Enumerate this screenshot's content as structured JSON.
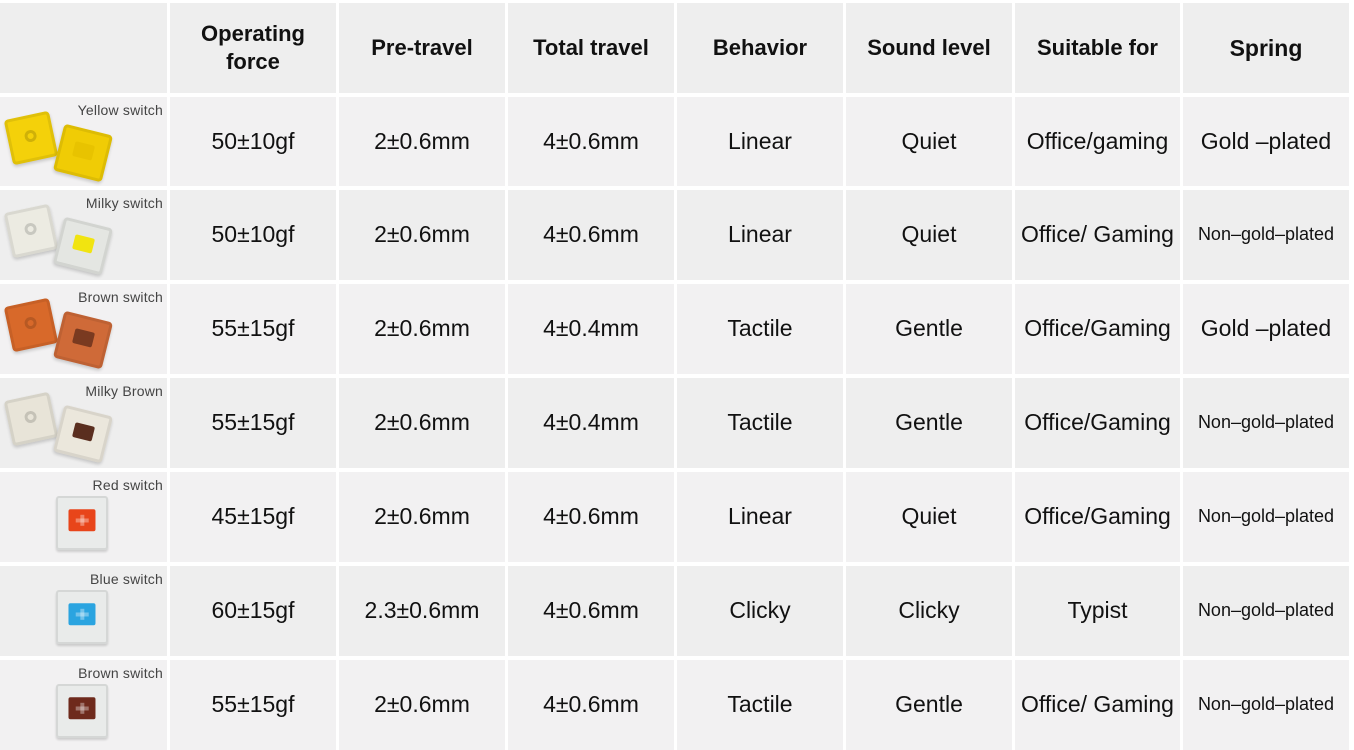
{
  "table": {
    "headers": [
      "",
      "Operating force",
      "Pre-travel",
      "Total travel",
      "Behavior",
      "Sound level",
      "Suitable for",
      "Spring"
    ],
    "header_lines": {
      "operating_force": [
        "Operating",
        "force"
      ]
    },
    "rows": [
      {
        "switch": "Yellow switch",
        "operating_force": "50±10gf",
        "pre_travel": "2±0.6mm",
        "total_travel": "4±0.6mm",
        "behavior": "Linear",
        "sound_level": "Quiet",
        "suitable_for": "Office/gaming",
        "spring": "Gold –plated"
      },
      {
        "switch": "Milky switch",
        "operating_force": "50±10gf",
        "pre_travel": "2±0.6mm",
        "total_travel": "4±0.6mm",
        "behavior": "Linear",
        "sound_level": "Quiet",
        "suitable_for": "Office/ Gaming",
        "spring": "Non–gold–plated"
      },
      {
        "switch": "Brown switch",
        "operating_force": "55±15gf",
        "pre_travel": "2±0.6mm",
        "total_travel": "4±0.4mm",
        "behavior": "Tactile",
        "sound_level": "Gentle",
        "suitable_for": "Office/Gaming",
        "spring": "Gold –plated"
      },
      {
        "switch": "Milky Brown",
        "operating_force": "55±15gf",
        "pre_travel": "2±0.6mm",
        "total_travel": "4±0.4mm",
        "behavior": "Tactile",
        "sound_level": "Gentle",
        "suitable_for": "Office/Gaming",
        "spring": "Non–gold–plated"
      },
      {
        "switch": "Red switch",
        "operating_force": "45±15gf",
        "pre_travel": "2±0.6mm",
        "total_travel": "4±0.6mm",
        "behavior": "Linear",
        "sound_level": "Quiet",
        "suitable_for": "Office/Gaming",
        "spring": "Non–gold–plated"
      },
      {
        "switch": "Blue switch",
        "operating_force": "60±15gf",
        "pre_travel": "2.3±0.6mm",
        "total_travel": "4±0.6mm",
        "behavior": "Clicky",
        "sound_level": "Clicky",
        "suitable_for": "Typist",
        "spring": "Non–gold–plated"
      },
      {
        "switch": "Brown switch",
        "operating_force": "55±15gf",
        "pre_travel": "2±0.6mm",
        "total_travel": "4±0.6mm",
        "behavior": "Tactile",
        "sound_level": "Gentle",
        "suitable_for": "Office/ Gaming",
        "spring": "Non–gold–plated"
      }
    ]
  },
  "switch_icons": [
    {
      "name": "yellow-switch-icon",
      "housing": "#f4d10a",
      "housing2": "#f0cc05",
      "stem": "#e8c300"
    },
    {
      "name": "milky-switch-icon",
      "housing": "#ecebe2",
      "housing2": "#e4e6e2",
      "stem": "#f1e410"
    },
    {
      "name": "brown-switch-icon",
      "housing": "#d8692a",
      "housing2": "#cf6a38",
      "stem": "#7a3a20"
    },
    {
      "name": "milky-brown-switch-icon",
      "housing": "#e8e4d8",
      "housing2": "#ebe7dc",
      "stem": "#5a2e1f"
    },
    {
      "name": "red-switch-icon",
      "housing": "#e9ebea",
      "housing2": "#e9ebea",
      "stem": "#e8451a"
    },
    {
      "name": "blue-switch-icon",
      "housing": "#e9ebea",
      "housing2": "#e9ebea",
      "stem": "#2aa4e0"
    },
    {
      "name": "brown-switch-icon",
      "housing": "#e9ebea",
      "housing2": "#e9ebea",
      "stem": "#6e2a1c"
    }
  ]
}
